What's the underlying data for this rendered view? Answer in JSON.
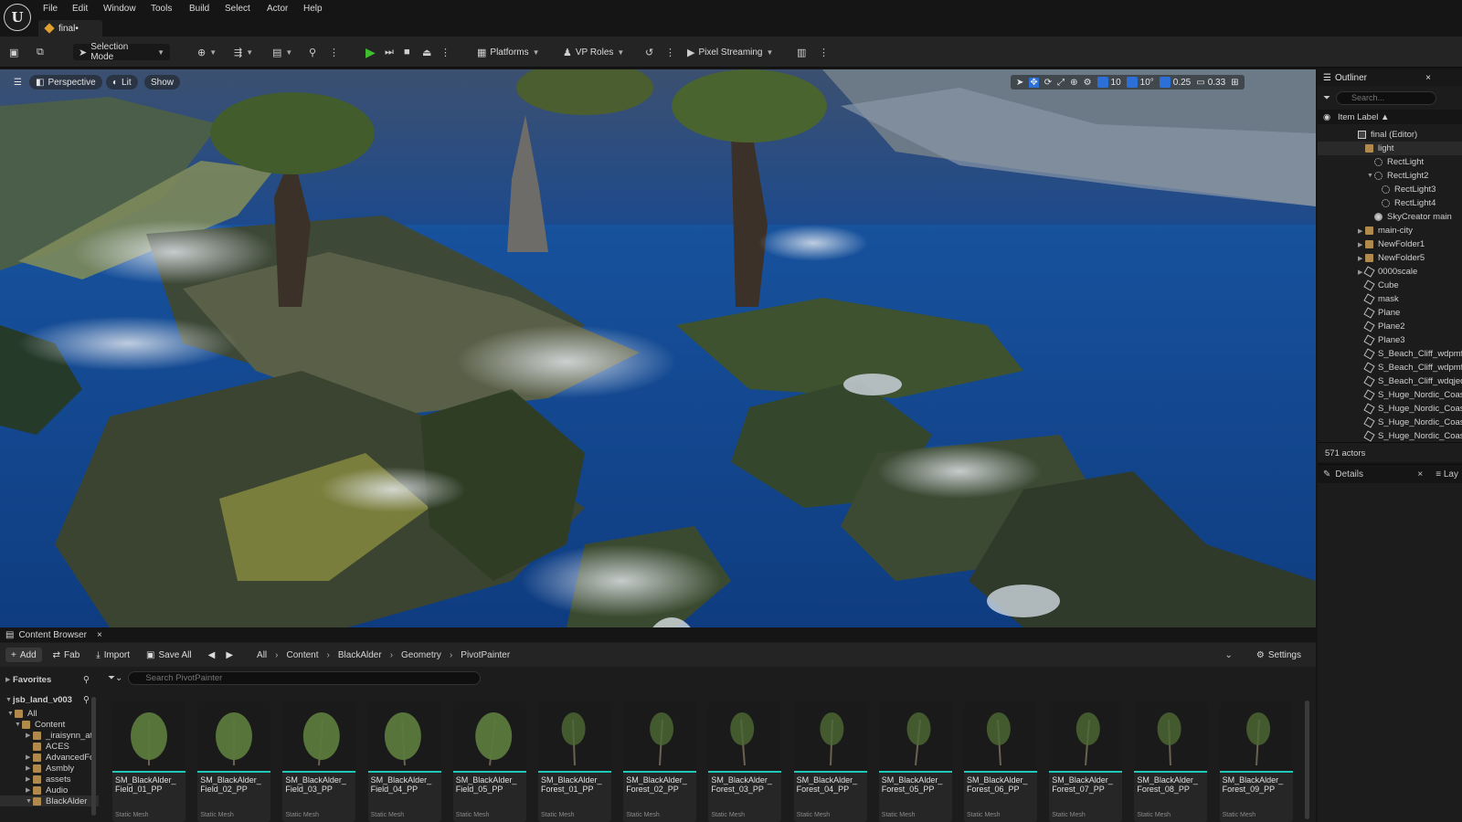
{
  "menubar": {
    "items": [
      "File",
      "Edit",
      "Window",
      "Tools",
      "Build",
      "Select",
      "Actor",
      "Help"
    ],
    "logo": "U",
    "tab": "final•"
  },
  "toolbar": {
    "selection_mode": "Selection Mode",
    "platforms": "Platforms",
    "vp_roles": "VP Roles",
    "pixel_streaming": "Pixel Streaming"
  },
  "viewport": {
    "perspective": "Perspective",
    "lit": "Lit",
    "show": "Show",
    "grid_snap": "10",
    "rotation_snap": "10°",
    "scale_snap": "0.25",
    "camera_speed": "0.33"
  },
  "outliner": {
    "title": "Outliner",
    "search_placeholder": "Search...",
    "column": "Item Label ▲",
    "rows": [
      {
        "label": "final (Editor)",
        "icon": "world"
      },
      {
        "label": "light",
        "icon": "folder"
      },
      {
        "label": "RectLight",
        "icon": "light"
      },
      {
        "label": "RectLight2",
        "icon": "light"
      },
      {
        "label": "RectLight3",
        "icon": "light"
      },
      {
        "label": "RectLight4",
        "icon": "light"
      },
      {
        "label": "SkyCreator main",
        "icon": "sky"
      },
      {
        "label": "main-city",
        "icon": "folder"
      },
      {
        "label": "NewFolder1",
        "icon": "folder"
      },
      {
        "label": "NewFolder5",
        "icon": "folder"
      },
      {
        "label": "0000scale",
        "icon": "mesh"
      },
      {
        "label": "Cube",
        "icon": "mesh"
      },
      {
        "label": "mask",
        "icon": "mesh"
      },
      {
        "label": "Plane",
        "icon": "mesh"
      },
      {
        "label": "Plane2",
        "icon": "mesh"
      },
      {
        "label": "Plane3",
        "icon": "mesh"
      },
      {
        "label": "S_Beach_Cliff_wdpmfh",
        "icon": "mesh"
      },
      {
        "label": "S_Beach_Cliff_wdpmfh",
        "icon": "mesh"
      },
      {
        "label": "S_Beach_Cliff_wdqjedv",
        "icon": "mesh"
      },
      {
        "label": "S_Huge_Nordic_Coast",
        "icon": "mesh"
      },
      {
        "label": "S_Huge_Nordic_Coast",
        "icon": "mesh"
      },
      {
        "label": "S_Huge_Nordic_Coast",
        "icon": "mesh"
      },
      {
        "label": "S_Huge_Nordic_Coast",
        "icon": "mesh"
      }
    ],
    "actor_count": "571 actors"
  },
  "details": {
    "title": "Details",
    "layers_tab": "Lay"
  },
  "content_browser": {
    "title": "Content Browser",
    "add": "Add",
    "fab": "Fab",
    "import": "Import",
    "save_all": "Save All",
    "breadcrumbs": [
      "All",
      "Content",
      "BlackAlder",
      "Geometry",
      "PivotPainter"
    ],
    "settings": "Settings",
    "favorites": "Favorites",
    "project": "jsb_land_v003",
    "search_placeholder": "Search PivotPainter",
    "tree": [
      "All",
      "Content",
      "_iraisynn_att",
      "ACES",
      "AdvancedFo",
      "Asmbly",
      "assets",
      "Audio",
      "BlackAlder"
    ],
    "assets": [
      {
        "name": "SM_BlackAlder_\nField_01_PP",
        "type": "Static Mesh"
      },
      {
        "name": "SM_BlackAlder_\nField_02_PP",
        "type": "Static Mesh"
      },
      {
        "name": "SM_BlackAlder_\nField_03_PP",
        "type": "Static Mesh"
      },
      {
        "name": "SM_BlackAlder_\nField_04_PP",
        "type": "Static Mesh"
      },
      {
        "name": "SM_BlackAlder_\nField_05_PP",
        "type": "Static Mesh"
      },
      {
        "name": "SM_BlackAlder_\nForest_01_PP",
        "type": "Static Mesh"
      },
      {
        "name": "SM_BlackAlder_\nForest_02_PP",
        "type": "Static Mesh"
      },
      {
        "name": "SM_BlackAlder_\nForest_03_PP",
        "type": "Static Mesh"
      },
      {
        "name": "SM_BlackAlder_\nForest_04_PP",
        "type": "Static Mesh"
      },
      {
        "name": "SM_BlackAlder_\nForest_05_PP",
        "type": "Static Mesh"
      },
      {
        "name": "SM_BlackAlder_\nForest_06_PP",
        "type": "Static Mesh"
      },
      {
        "name": "SM_BlackAlder_\nForest_07_PP",
        "type": "Static Mesh"
      },
      {
        "name": "SM_BlackAlder_\nForest_08_PP",
        "type": "Static Mesh"
      },
      {
        "name": "SM_BlackAlder_\nForest_09_PP",
        "type": "Static Mesh"
      }
    ]
  },
  "colors": {
    "accent": "#2c6fd6",
    "play_green": "#3fbf2f",
    "asset_underline": "#20c8b8",
    "folder": "#b08a4a"
  }
}
